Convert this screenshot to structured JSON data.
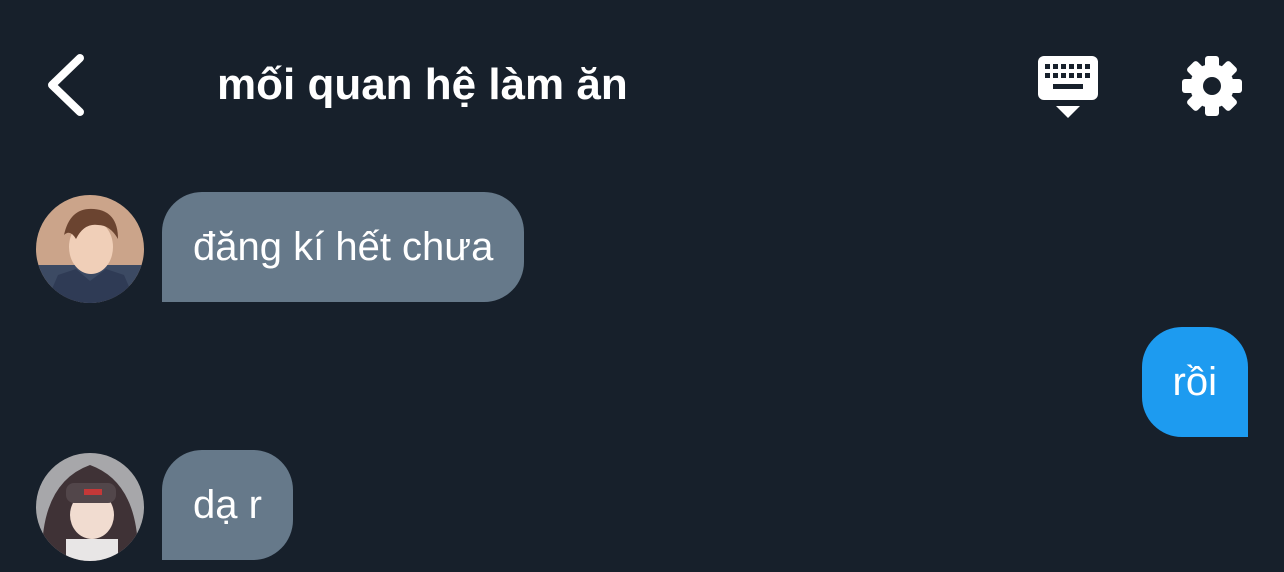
{
  "header": {
    "title": "mối quan hệ làm ăn",
    "back_icon": "chevron-left-icon",
    "keyboard_icon": "keyboard-icon",
    "settings_icon": "gear-icon"
  },
  "messages": [
    {
      "direction": "incoming",
      "text": "đăng kí hết chưa"
    },
    {
      "direction": "outgoing",
      "text": "rồi"
    },
    {
      "direction": "incoming",
      "text": "dạ r"
    }
  ],
  "colors": {
    "background": "#17202b",
    "incoming_bubble": "#66798a",
    "outgoing_bubble": "#1d9bf0",
    "text": "#ffffff"
  }
}
